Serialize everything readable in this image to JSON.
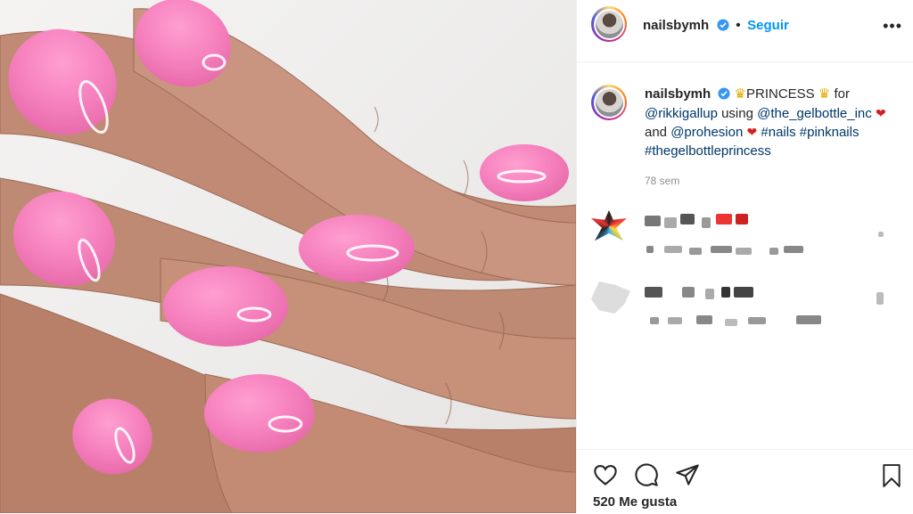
{
  "post": {
    "username": "nailsbymh",
    "follow_label": "Seguir",
    "caption": {
      "title": "PRINCESS",
      "for_word": "for",
      "mention1": "@rikkigallup",
      "using_word": "using",
      "mention2": "@the_gelbottle_inc",
      "and_word": "and",
      "mention3": "@prohesion",
      "tag1": "#nails",
      "tag2": "#pinknails",
      "tag3": "#thegelbottleprincess"
    },
    "time_ago": "78 sem",
    "likes": "520 Me gusta"
  },
  "icons": {
    "verified": "verified-badge-icon",
    "more": "more-options-icon",
    "like": "heart-icon",
    "comment": "comment-icon",
    "share": "share-icon",
    "save": "bookmark-icon"
  },
  "colors": {
    "accent": "#0095f6",
    "link": "#00376b",
    "muted": "#8e8e8e",
    "nail_pink": "#f57fbd"
  }
}
